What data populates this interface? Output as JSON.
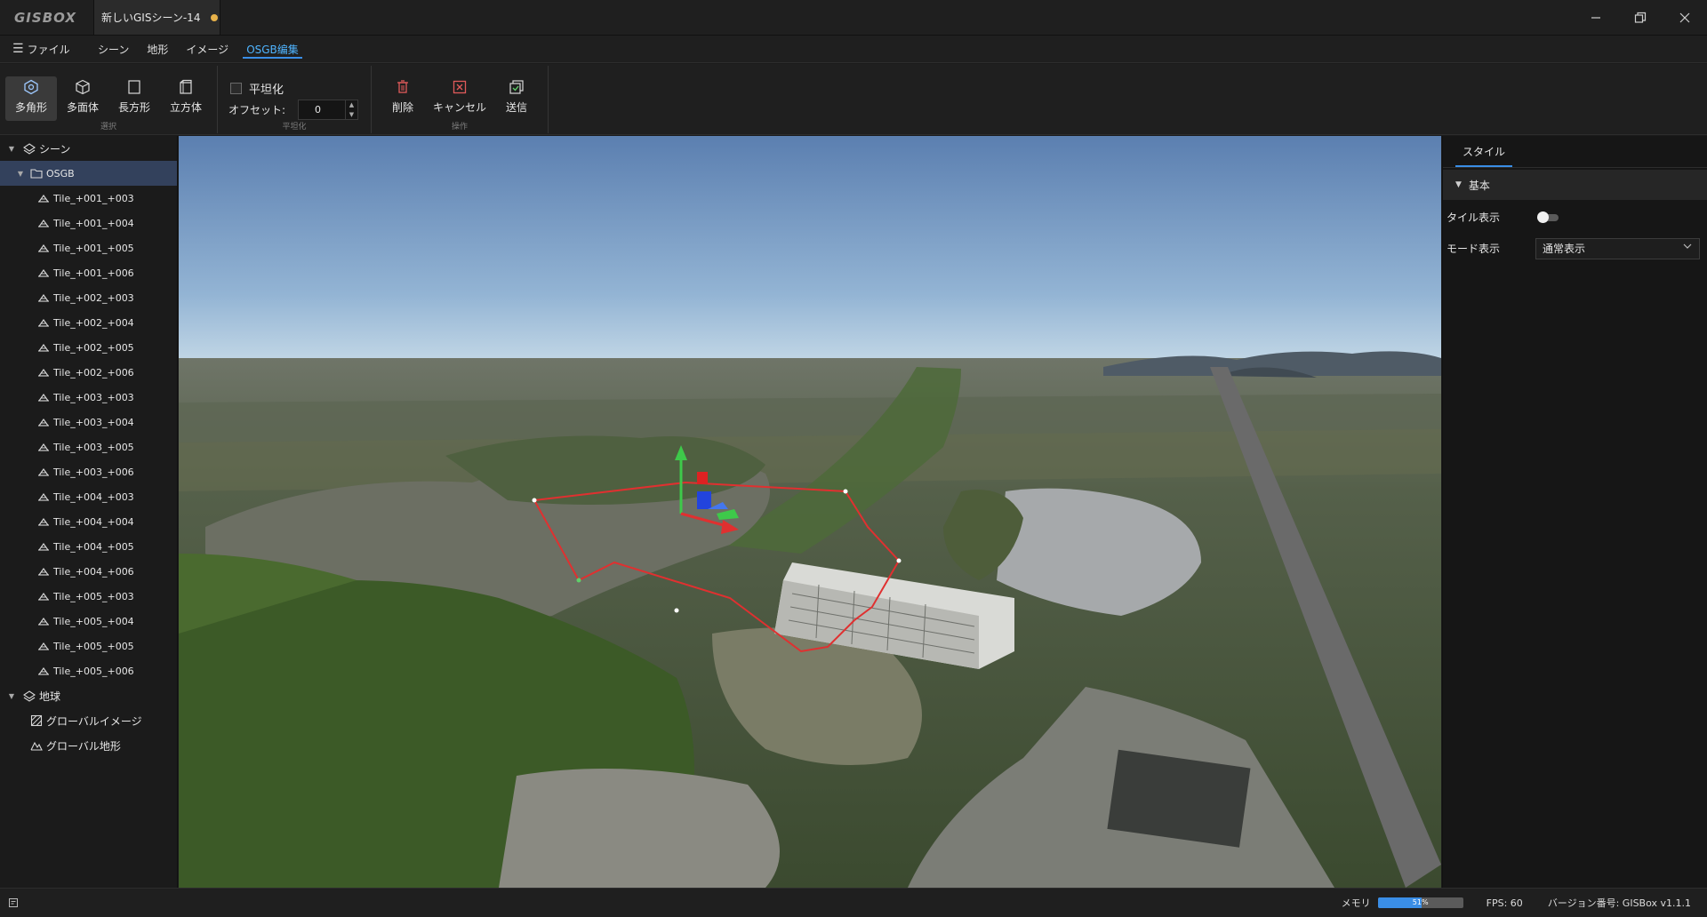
{
  "app": {
    "logo": "GISBOX"
  },
  "document_tab": {
    "label": "新しいGISシーン-14"
  },
  "window_controls": {
    "minimize": "—",
    "restore": "❐",
    "close": "✕"
  },
  "menu": {
    "file_label": "ファイル",
    "tabs": [
      {
        "label": "シーン"
      },
      {
        "label": "地形"
      },
      {
        "label": "イメージ"
      },
      {
        "label": "OSGB编集",
        "active": true
      }
    ]
  },
  "ribbon": {
    "select_group": {
      "caption": "選択",
      "buttons": [
        {
          "label": "多角形",
          "icon": "polygon-icon",
          "selected": true
        },
        {
          "label": "多面体",
          "icon": "polyhedron-icon"
        },
        {
          "label": "長方形",
          "icon": "rectangle-icon"
        },
        {
          "label": "立方体",
          "icon": "cube-icon"
        }
      ]
    },
    "flatten_group": {
      "caption": "平坦化",
      "checkbox_label": "平坦化",
      "checked": false,
      "offset_label": "オフセット:",
      "offset_value": "0"
    },
    "operation_group": {
      "caption": "操作",
      "buttons": [
        {
          "label": "削除",
          "icon": "trash-icon"
        },
        {
          "label": "キャンセル",
          "icon": "cancel-icon"
        },
        {
          "label": "送信",
          "icon": "send-icon"
        }
      ]
    }
  },
  "tree": {
    "scene_label": "シーン",
    "osgb_label": "OSGB",
    "tiles": [
      "Tile_+001_+003",
      "Tile_+001_+004",
      "Tile_+001_+005",
      "Tile_+001_+006",
      "Tile_+002_+003",
      "Tile_+002_+004",
      "Tile_+002_+005",
      "Tile_+002_+006",
      "Tile_+003_+003",
      "Tile_+003_+004",
      "Tile_+003_+005",
      "Tile_+003_+006",
      "Tile_+004_+003",
      "Tile_+004_+004",
      "Tile_+004_+005",
      "Tile_+004_+006",
      "Tile_+005_+003",
      "Tile_+005_+004",
      "Tile_+005_+005",
      "Tile_+005_+006"
    ],
    "earth_label": "地球",
    "global_image_label": "グローバルイメージ",
    "global_terrain_label": "グローバル地形"
  },
  "right_panel": {
    "tab_label": "スタイル",
    "section_label": "基本",
    "tile_display_label": "タイル表示",
    "tile_display_on": false,
    "mode_display_label": "モード表示",
    "mode_display_value": "通常表示"
  },
  "status": {
    "memory_label": "メモリ",
    "memory_percent": 51,
    "memory_text": "51%",
    "fps_text": "FPS: 60",
    "version_text": "バージョン番号: GISBox v1.1.1"
  },
  "colors": {
    "accent": "#3a8ee6",
    "active_tab_text": "#4fb4ff",
    "selected_row": "#33415c",
    "modified_dot": "#e8b24a"
  }
}
